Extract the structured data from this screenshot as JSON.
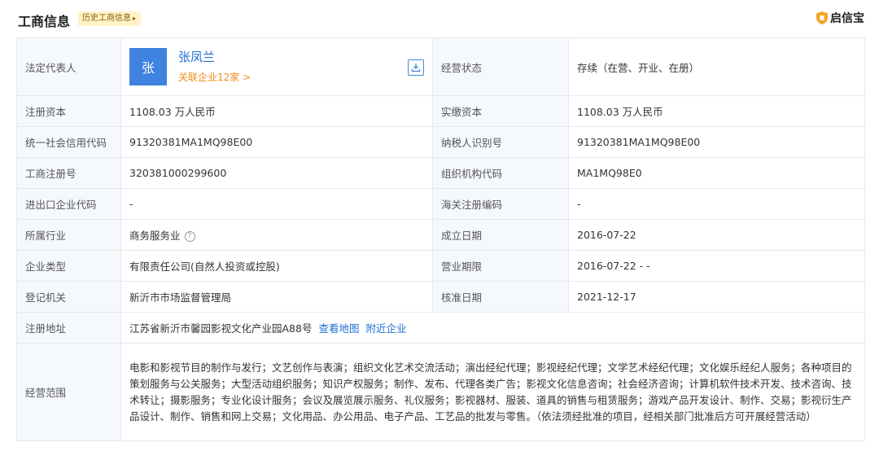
{
  "header": {
    "title": "工商信息",
    "history_tag": "历史工商信息",
    "brand_name": "启信宝"
  },
  "legal": {
    "label": "法定代表人",
    "avatar_char": "张",
    "name": "张凤兰",
    "related": "关联企业12家 >",
    "status_label": "经营状态",
    "status_value": "存续（在营、开业、在册）"
  },
  "rows": [
    {
      "l1": "注册资本",
      "v1": "1108.03 万人民币",
      "l2": "实缴资本",
      "v2": "1108.03 万人民币"
    },
    {
      "l1": "统一社会信用代码",
      "v1": "91320381MA1MQ98E00",
      "l2": "纳税人识别号",
      "v2": "91320381MA1MQ98E00"
    },
    {
      "l1": "工商注册号",
      "v1": "320381000299600",
      "l2": "组织机构代码",
      "v2": "MA1MQ98E0"
    },
    {
      "l1": "进出口企业代码",
      "v1": "-",
      "l2": "海关注册编码",
      "v2": "-"
    },
    {
      "l1": "所属行业",
      "v1": "商务服务业",
      "l2": "成立日期",
      "v2": "2016-07-22"
    },
    {
      "l1": "企业类型",
      "v1": "有限责任公司(自然人投资或控股)",
      "l2": "营业期限",
      "v2": "2016-07-22 - -"
    },
    {
      "l1": "登记机关",
      "v1": "新沂市市场监督管理局",
      "l2": "核准日期",
      "v2": "2021-12-17"
    }
  ],
  "address": {
    "label": "注册地址",
    "value": "江苏省新沂市馨园影视文化产业园A88号",
    "map_link": "查看地图",
    "nearby_link": "附近企业"
  },
  "scope": {
    "label": "经营范围",
    "value": "电影和影视节目的制作与发行；文艺创作与表演；组织文化艺术交流活动；演出经纪代理；影视经纪代理；文学艺术经纪代理；文化娱乐经纪人服务；各种项目的策划服务与公关服务；大型活动组织服务；知识产权服务；制作、发布、代理各类广告；影视文化信息咨询；社会经济咨询；计算机软件技术开发、技术咨询、技术转让；摄影服务；专业化设计服务；会议及展览展示服务、礼仪服务；影视器材、服装、道具的销售与租赁服务；游戏产品开发设计、制作、交易；影视衍生产品设计、制作、销售和网上交易；文化用品、办公用品、电子产品、工艺品的批发与零售。（依法须经批准的项目，经相关部门批准后方可开展经营活动）"
  },
  "colors": {
    "accent": "#1f6fd6",
    "avatar_bg": "#3f82e0",
    "related_link": "#f08c1a",
    "label_bg": "#f5f8fc",
    "tag_bg": "#fff3c7",
    "brand_shield": "#f5a623"
  }
}
